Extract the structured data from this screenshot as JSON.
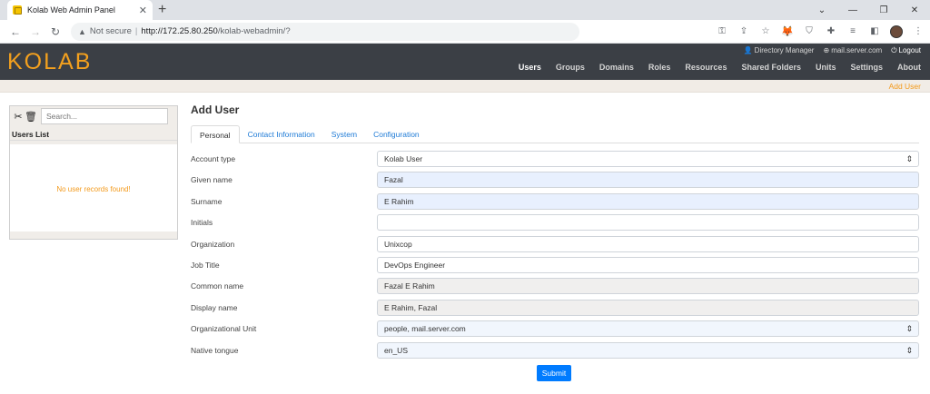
{
  "browser": {
    "tab_title": "Kolab Web Admin Panel",
    "not_secure": "Not secure",
    "url_host": "http://172.25.80.250",
    "url_path": "/kolab-webadmin/?"
  },
  "header": {
    "logo": "KOLAB",
    "user": "Directory Manager",
    "server": "mail.server.com",
    "logout": "Logout",
    "nav": [
      "Users",
      "Groups",
      "Domains",
      "Roles",
      "Resources",
      "Shared Folders",
      "Units",
      "Settings",
      "About"
    ],
    "active_nav": "Users",
    "subbar_link": "Add User"
  },
  "sidebar": {
    "search_placeholder": "Search...",
    "list_title": "Users List",
    "empty_message": "No user records found!"
  },
  "form": {
    "title": "Add User",
    "tabs": [
      "Personal",
      "Contact Information",
      "System",
      "Configuration"
    ],
    "active_tab": "Personal",
    "fields": [
      {
        "label": "Account type",
        "value": "Kolab User"
      },
      {
        "label": "Given name",
        "value": "Fazal"
      },
      {
        "label": "Surname",
        "value": "E Rahim"
      },
      {
        "label": "Initials",
        "value": ""
      },
      {
        "label": "Organization",
        "value": "Unixcop"
      },
      {
        "label": "Job Title",
        "value": "DevOps Engineer"
      },
      {
        "label": "Common name",
        "value": "Fazal E Rahim"
      },
      {
        "label": "Display name",
        "value": "E Rahim, Fazal"
      },
      {
        "label": "Organizational Unit",
        "value": "people, mail.server.com"
      },
      {
        "label": "Native tongue",
        "value": "en_US"
      }
    ],
    "submit": "Submit"
  }
}
